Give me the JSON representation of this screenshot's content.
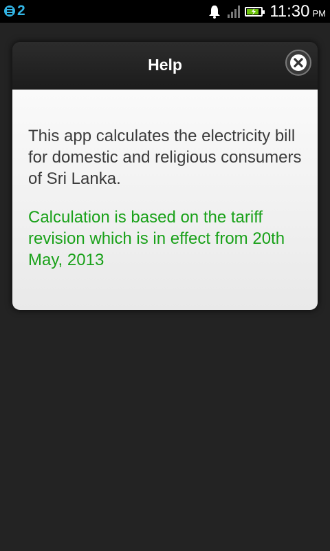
{
  "status_bar": {
    "notification_count": "2",
    "time": "11:30",
    "ampm": "PM",
    "battery_level": 0.85,
    "icons": [
      "notification-badge-icon",
      "bell-icon",
      "signal-icon",
      "battery-charging-icon"
    ]
  },
  "dialog": {
    "title": "Help",
    "close_icon": "close-icon",
    "description": "This app calculates the electricity bill for domestic and religious consumers of Sri Lanka.",
    "note": "Calculation is based on the tariff revision which is in effect from 20th May, 2013"
  },
  "colors": {
    "note_text": "#19a119",
    "body_text": "#3b3b3b",
    "accent": "#33b5e5",
    "battery": "#6cc20b"
  }
}
